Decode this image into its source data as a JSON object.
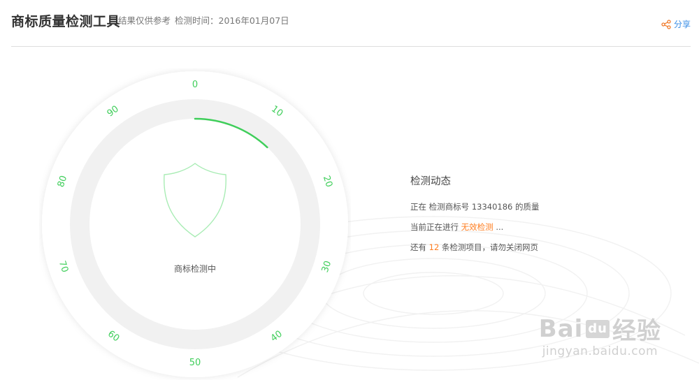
{
  "header": {
    "title": "商标质量检测工具",
    "note": "结果仅供参考",
    "time_label": "检测时间：",
    "time_value": "2016年01月07日",
    "share_label": "分享"
  },
  "dial": {
    "ticks": [
      "0",
      "10",
      "20",
      "30",
      "40",
      "50",
      "60",
      "70",
      "80",
      "90"
    ],
    "progress_value": 12,
    "progress_max": 100,
    "status": "商标检测中"
  },
  "panel": {
    "title": "检测动态",
    "line1_prefix": "正在 检测商标号",
    "trademark_no": "13340186",
    "line1_suffix": "的质量",
    "line2_prefix": "当前正在进行",
    "current_item": "无效检测",
    "line2_suffix": "...",
    "line3_prefix": "还有",
    "remaining": "12",
    "line3_suffix": "条检测项目，请勿关闭网页"
  },
  "watermark": {
    "logo_left": "Bai",
    "logo_mid": "du",
    "logo_right": "经验",
    "url": "jingyan.baidu.com"
  },
  "colors": {
    "accent_green": "#3fce5a",
    "highlight_orange": "#ff7d1f",
    "link_blue": "#3a8ee6"
  }
}
